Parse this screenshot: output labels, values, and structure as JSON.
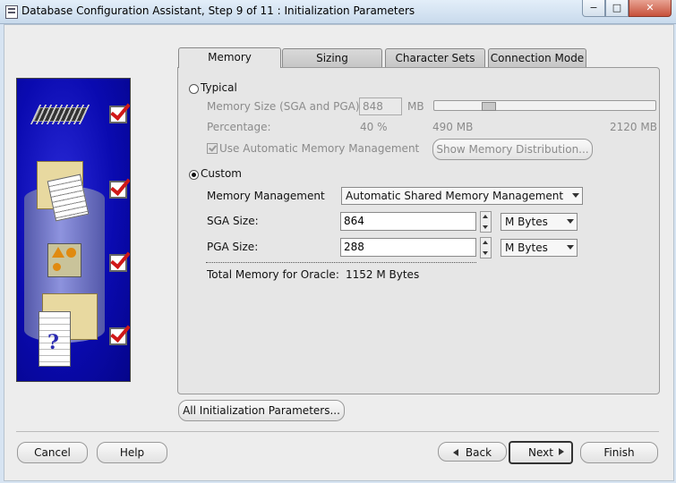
{
  "window": {
    "title": "Database Configuration Assistant, Step 9 of 11 : Initialization Parameters",
    "min_glyph": "−",
    "max_glyph": "□",
    "close_glyph": "✕"
  },
  "tabs": [
    {
      "label": "Memory",
      "active": true
    },
    {
      "label": "Sizing",
      "active": false
    },
    {
      "label": "Character Sets",
      "active": false
    },
    {
      "label": "Connection Mode",
      "active": false
    }
  ],
  "memory": {
    "typical": {
      "label": "Typical",
      "selected": false,
      "memory_size_label": "Memory Size (SGA and PGA):",
      "memory_size_value": "848",
      "memory_size_unit": "MB",
      "percentage_label": "Percentage:",
      "percentage_value": "40 %",
      "slider_current": "490 MB",
      "slider_max": "2120 MB",
      "slider_fraction": 0.4,
      "amm_label": "Use Automatic Memory Management",
      "amm_checked": true,
      "show_distribution_label": "Show Memory Distribution..."
    },
    "custom": {
      "label": "Custom",
      "selected": true,
      "management_label": "Memory Management",
      "management_value": "Automatic Shared Memory Management",
      "sga_label": "SGA Size:",
      "sga_value": "864",
      "sga_unit": "M Bytes",
      "pga_label": "PGA Size:",
      "pga_value": "288",
      "pga_unit": "M Bytes",
      "total_label": "Total Memory for Oracle:",
      "total_value": "1152 M Bytes"
    }
  },
  "all_params_label": "All Initialization Parameters...",
  "footer": {
    "cancel": "Cancel",
    "help": "Help",
    "back": "Back",
    "next": "Next",
    "finish": "Finish"
  }
}
